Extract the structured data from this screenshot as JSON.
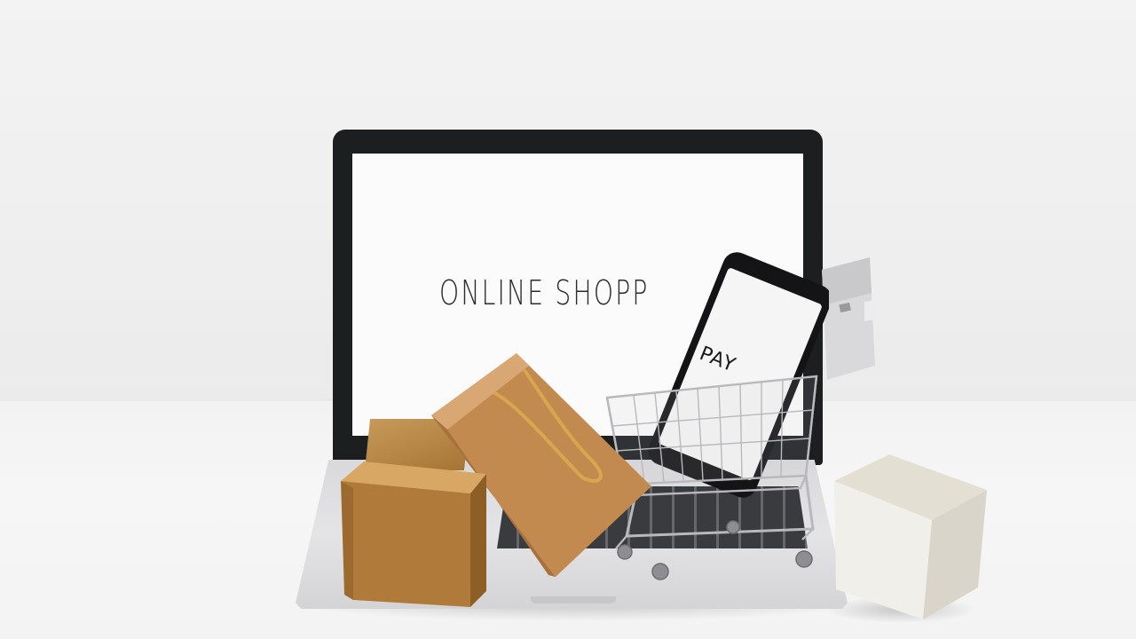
{
  "photo": {
    "screen_text": "ONLINE SHOPPING",
    "phone_text": "PAY"
  },
  "colors": {
    "background": "#f1f1f1",
    "laptop_bezel": "#1d1e20",
    "laptop_body": "#dcdcde",
    "kraft_box": "#b27f3e",
    "white_cube": "#e6e3dc",
    "cart_metal": "#b9b9bd"
  },
  "icons": [
    "laptop-icon",
    "smartphone-icon",
    "shopping-cart-icon",
    "shopping-bag-icon",
    "gift-box-icon",
    "credit-card-icon"
  ]
}
